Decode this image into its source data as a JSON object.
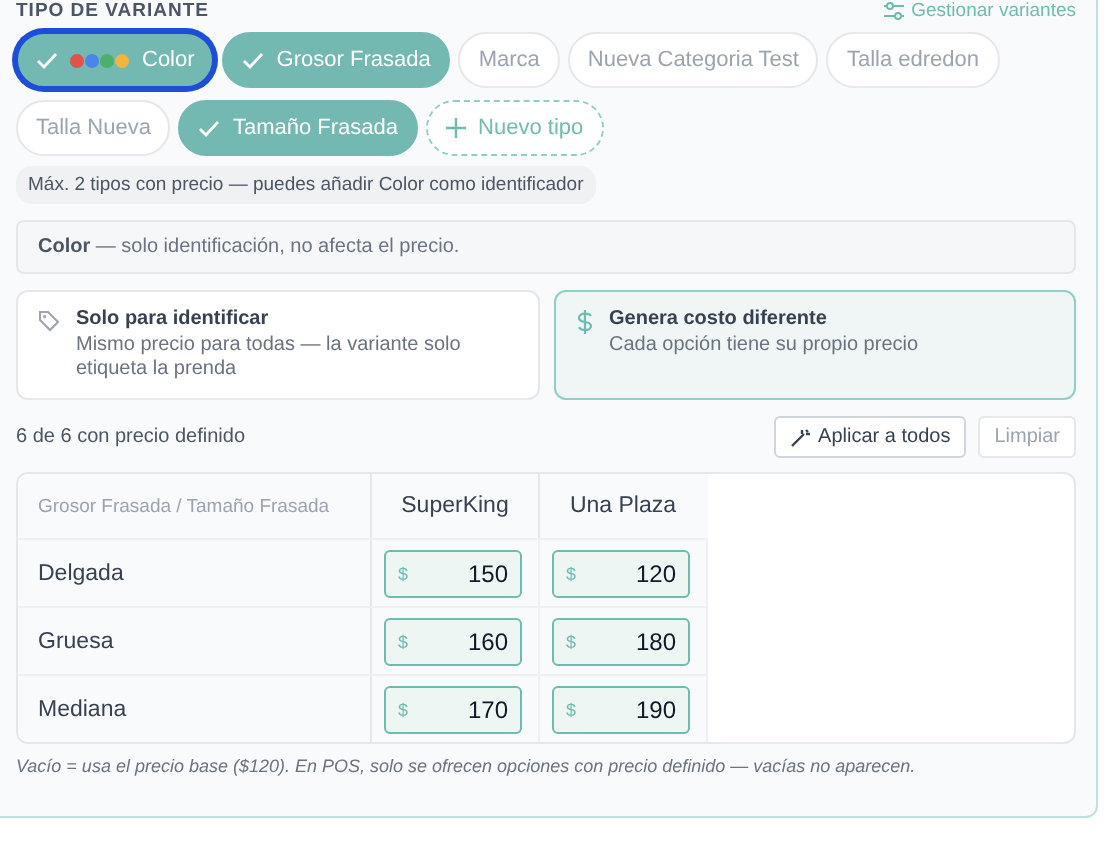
{
  "section": {
    "title": "TIPO DE VARIANTE",
    "manage_link": "Gestionar variantes"
  },
  "chips": [
    {
      "kind": "color",
      "label": "Color",
      "selected": true,
      "focused": true
    },
    {
      "kind": "plain",
      "label": "Grosor Frasada",
      "selected": true,
      "focused": false
    },
    {
      "kind": "plain",
      "label": "Marca",
      "selected": false,
      "focused": false
    },
    {
      "kind": "plain",
      "label": "Nueva Categoria Test",
      "selected": false,
      "focused": false
    },
    {
      "kind": "plain",
      "label": "Talla edredon",
      "selected": false,
      "focused": false
    },
    {
      "kind": "plain",
      "label": "Talla Nueva",
      "selected": false,
      "focused": false
    },
    {
      "kind": "plain",
      "label": "Tamaño Frasada",
      "selected": true,
      "focused": false
    }
  ],
  "new_type_button": "Nuevo tipo",
  "limit_hint": "Máx. 2 tipos con precio — puedes añadir Color como identificador",
  "color_note": "**Color** — solo identificación, no afecta el precio.",
  "price_modes": [
    {
      "kind": "tag",
      "title": "Solo para identificar",
      "description": "Mismo precio para todas — la variante solo etiqueta la prenda",
      "selected": false
    },
    {
      "kind": "dollar",
      "title": "Genera costo diferente",
      "description": "Cada opción tiene su propio precio",
      "selected": true
    }
  ],
  "price_count": "6 de 6 con precio definido",
  "apply_all_button": "Aplicar a todos",
  "clear_button": "Limpiar",
  "table": {
    "corner": "Grosor Frasada / Tamaño Frasada",
    "columns": [
      "SuperKing",
      "Una Plaza"
    ],
    "rows": [
      {
        "label": "Delgada",
        "prices": [
          {
            "currency": "$",
            "value": "150"
          },
          {
            "currency": "$",
            "value": "120"
          }
        ]
      },
      {
        "label": "Gruesa",
        "prices": [
          {
            "currency": "$",
            "value": "160"
          },
          {
            "currency": "$",
            "value": "180"
          }
        ]
      },
      {
        "label": "Mediana",
        "prices": [
          {
            "currency": "$",
            "value": "170"
          },
          {
            "currency": "$",
            "value": "190"
          }
        ]
      }
    ]
  },
  "footnote": "Vacío = usa el precio base ($120). En POS, solo se ofrecen opciones con precio definido — vacías no aparecen."
}
